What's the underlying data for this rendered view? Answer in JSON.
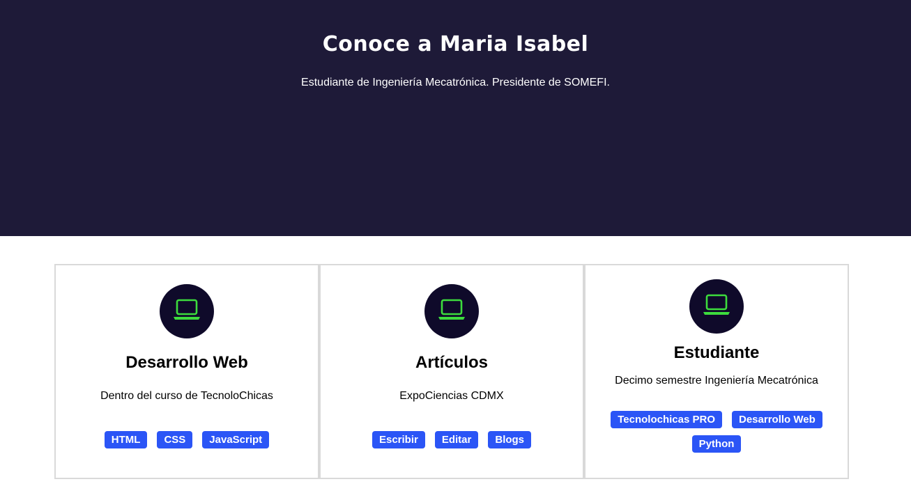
{
  "hero": {
    "title": "Conoce a Maria Isabel",
    "subtitle": "Estudiante de Ingeniería Mecatrónica. Presidente de SOMEFI.",
    "background": "#1e1a38"
  },
  "cards": [
    {
      "icon": "laptop-icon",
      "title": "Desarrollo Web",
      "description": "Dentro del curso de TecnoloChicas",
      "tags": [
        "HTML",
        "CSS",
        "JavaScript"
      ]
    },
    {
      "icon": "laptop-icon",
      "title": "Artículos",
      "description": "ExpoCiencias CDMX",
      "tags": [
        "Escribir",
        "Editar",
        "Blogs"
      ]
    },
    {
      "icon": "laptop-icon",
      "title": "Estudiante",
      "description": "Decimo semestre Ingeniería Mecatrónica",
      "tags": [
        "Tecnolochicas PRO",
        "Desarrollo Web",
        "Python"
      ]
    }
  ],
  "colors": {
    "icon_green": "#3ddc3d",
    "icon_circle": "#0f0a2a",
    "tag_blue": "#2b55f6",
    "card_border": "#d9d9d9"
  }
}
